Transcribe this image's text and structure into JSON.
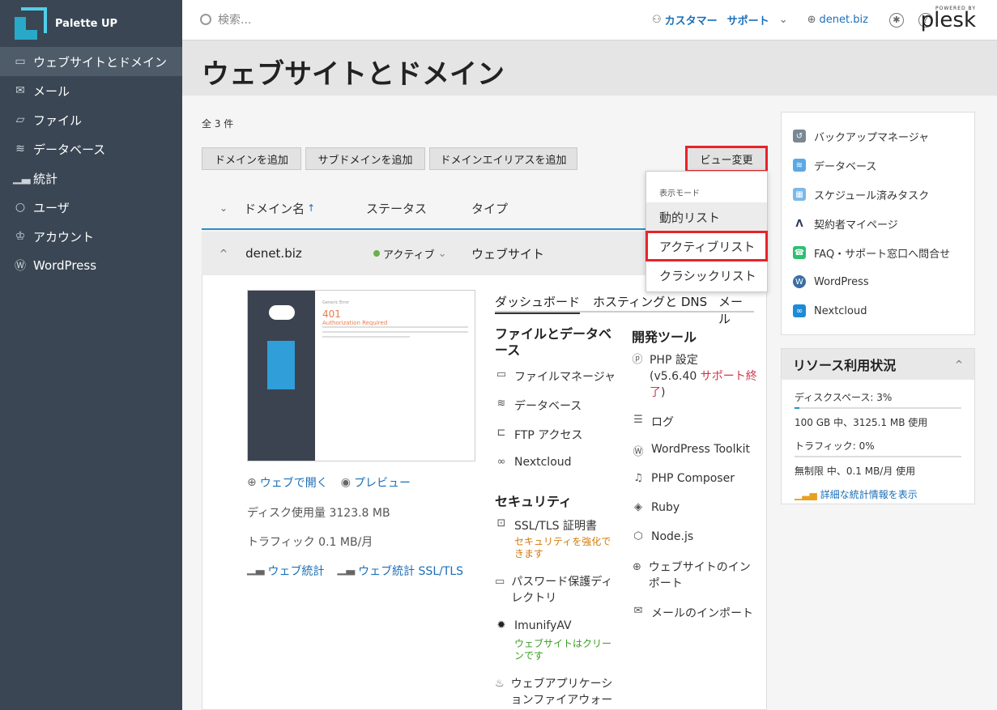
{
  "brand": {
    "name": "Palette UP"
  },
  "sidebar": {
    "items": [
      {
        "label": "ウェブサイトとドメイン",
        "icon": "monitor-icon"
      },
      {
        "label": "メール",
        "icon": "mail-icon"
      },
      {
        "label": "ファイル",
        "icon": "folder-icon"
      },
      {
        "label": "データベース",
        "icon": "database-icon"
      },
      {
        "label": "統計",
        "icon": "chart-icon"
      },
      {
        "label": "ユーザ",
        "icon": "user-icon"
      },
      {
        "label": "アカウント",
        "icon": "crown-icon"
      },
      {
        "label": "WordPress",
        "icon": "wordpress-icon"
      }
    ]
  },
  "topbar": {
    "search_placeholder": "検索...",
    "customer": "カスタマー",
    "support": "サポート",
    "domain": "denet.biz",
    "powered": "POWERED BY",
    "plesk": "plesk"
  },
  "page": {
    "title": "ウェブサイトとドメイン",
    "count": "全 3 件"
  },
  "toolbar": {
    "add_domain": "ドメインを追加",
    "add_subdomain": "サブドメインを追加",
    "add_alias": "ドメインエイリアスを追加",
    "view_change": "ビュー変更"
  },
  "table": {
    "col_domain": "ドメイン名",
    "col_sort": "↑",
    "col_status": "ステータス",
    "col_type": "タイプ"
  },
  "row": {
    "domain": "denet.biz",
    "status": "アクティブ",
    "type": "ウェブサイト"
  },
  "preview": {
    "small": "Generic Error",
    "code": "401",
    "msg": "Authorization Required"
  },
  "site": {
    "open": "ウェブで開く",
    "preview": "プレビュー",
    "disk": "ディスク使用量 3123.8 MB",
    "traffic": "トラフィック 0.1 MB/月",
    "stats": "ウェブ統計",
    "stats_ssl": "ウェブ統計 SSL/TLS"
  },
  "tabs": [
    "ダッシュボード",
    "ホスティングと DNS",
    "メール"
  ],
  "files": {
    "title": "ファイルとデータベース",
    "items": [
      "ファイルマネージャ",
      "データベース",
      "FTP アクセス",
      "Nextcloud"
    ]
  },
  "security": {
    "title": "セキュリティ",
    "ssl": "SSL/TLS 証明書",
    "ssl_warn": "セキュリティを強化できます",
    "pw": "パスワード保護ディレクトリ",
    "imunify": "ImunifyAV",
    "imunify_ok": "ウェブサイトはクリーンです",
    "waf": "ウェブアプリケーションファイアウォー"
  },
  "dev": {
    "title": "開発ツール",
    "php": "PHP 設定",
    "php_ver_a": "(v5.6.40 ",
    "php_eol": "サポート終了",
    "php_ver_b": ")",
    "items": [
      "ログ",
      "WordPress Toolkit",
      "PHP Composer",
      "Ruby",
      "Node.js",
      "ウェブサイトのインポート",
      "メールのインポート"
    ]
  },
  "dropdown": {
    "header": "表示モード",
    "items": [
      "動的リスト",
      "アクティブリスト",
      "クラシックリスト"
    ]
  },
  "right": {
    "items": [
      "バックアップマネージャ",
      "データベース",
      "スケジュール済みタスク",
      "契約者マイページ",
      "FAQ・サポート窓口へ問合せ",
      "WordPress",
      "Nextcloud"
    ]
  },
  "resources": {
    "title": "リソース利用状況",
    "disk_label": "ディスクスペース: 3%",
    "disk_percent": 3,
    "disk_detail": "100 GB 中、3125.1 MB 使用",
    "traffic_label": "トラフィック: 0%",
    "traffic_percent": 0,
    "traffic_detail": "無制限 中、0.1 MB/月 使用",
    "stats_link": "詳細な統計情報を表示"
  }
}
